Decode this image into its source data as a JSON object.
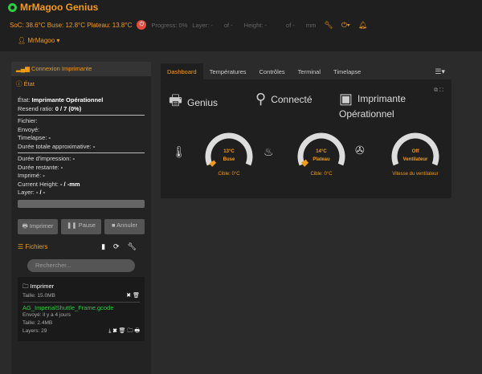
{
  "header": {
    "brand": "MrMagoo Genius",
    "soc": "SoC: 38.6°C Buse: 12.8°C Plateau: 13.8°C",
    "progress": "Progress: 0%",
    "layer_label": "Layer: -",
    "layer_of": "of -",
    "height_label": "Height: -",
    "height_of": "of -",
    "height_unit": "mm",
    "user": "MrMagoo"
  },
  "left": {
    "connexion": "Connexion Imprimante",
    "etat_title": "État",
    "etat_label": "État: ",
    "etat_value": "Imprimante Opérationnel",
    "resend_label": "Resend ratio: ",
    "resend_value": "0 / 7 (0%)",
    "fichier": "Fichier:",
    "envoye": "Envoyé:",
    "timelapse_label": "Timelapse: ",
    "timelapse_value": "-",
    "duree_totale_label": "Durée totale approximative: ",
    "duree_totale_value": "-",
    "duree_impression_label": "Durée d'impression: ",
    "duree_impression_value": "-",
    "duree_restante_label": "Durée restante: ",
    "duree_restante_value": "-",
    "imprime_label": "Imprimé: ",
    "imprime_value": "-",
    "current_height_label": "Current Height: ",
    "current_height_value": "- / -mm",
    "layer_label": "Layer: ",
    "layer_value": "- / -",
    "btn_print": "Imprimer",
    "btn_pause": "Pause",
    "btn_cancel": "Annuler",
    "files_title": "Fichiers",
    "search_placeholder": "Rechercher...",
    "files": [
      {
        "name": "Imprimer",
        "meta1": "Taille: 15.0MB"
      },
      {
        "name": "AG_ImperialShuttle_Frame.gcode",
        "meta1": "Envoyé: il y a 4 jours",
        "meta2": "Taille: 2.4MB",
        "meta3": "Layers: 29"
      }
    ]
  },
  "tabs": [
    "Dashboard",
    "Températures",
    "Contrôles",
    "Terminal",
    "Timelapse"
  ],
  "dashboard": {
    "genius": "Genius",
    "connecte": "Connecté",
    "imprimante": "Imprimante",
    "operationnel": "Opérationnel",
    "gauges": [
      {
        "value": "13°C",
        "name": "Buse",
        "target": "Cible: 0°C",
        "fraction": 0.04
      },
      {
        "value": "14°C",
        "name": "Plateau",
        "target": "Cible: 0°C",
        "fraction": 0.05
      },
      {
        "value": "Off",
        "name": "Ventilateur",
        "target": "Vitesse du ventilateur",
        "fraction": 0.0
      }
    ]
  },
  "colors": {
    "accent": "#f39c12",
    "bg": "#2b2b2b",
    "success": "#2ecc40",
    "danger": "#e74c3c"
  }
}
